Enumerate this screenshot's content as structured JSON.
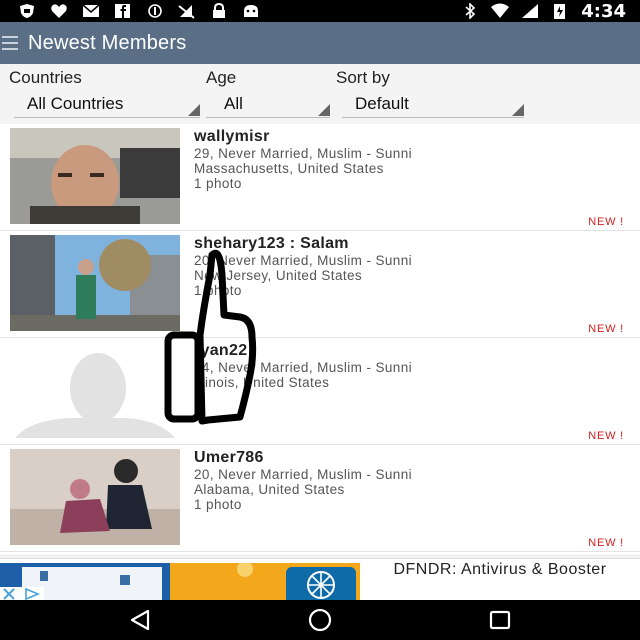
{
  "status_bar": {
    "time": "4:34",
    "icons_left": [
      "shield-icon",
      "heart-icon",
      "mail-icon",
      "facebook-icon",
      "circle-icon",
      "no-signal-icon",
      "lock-icon",
      "android-icon"
    ],
    "icons_right": [
      "bluetooth-icon",
      "wifi-icon",
      "signal-icon",
      "battery-icon"
    ]
  },
  "app_bar": {
    "title": "Newest Members"
  },
  "filters": {
    "countries": {
      "label": "Countries",
      "value": "All Countries"
    },
    "age": {
      "label": "Age",
      "value": "All"
    },
    "sort_by": {
      "label": "Sort by",
      "value": "Default"
    }
  },
  "members": [
    {
      "username": "wallymisr",
      "details": "29, Never Married, Muslim - Sunni",
      "location": "Massachusetts, United States",
      "photos": "1 photo",
      "badge": "NEW !"
    },
    {
      "username": "shehary123 : Salam",
      "details": "20, Never Married, Muslim - Sunni",
      "location": "New Jersey, United States",
      "photos": "1 photo",
      "badge": "NEW !"
    },
    {
      "username": "ryan22",
      "details": "34, Never Married, Muslim - Sunni",
      "location": "Illinois, United States",
      "photos": "",
      "badge": "NEW !"
    },
    {
      "username": "Umer786",
      "details": "20, Never Married, Muslim - Sunni",
      "location": "Alabama, United States",
      "photos": "1 photo",
      "badge": "NEW !"
    }
  ],
  "ad": {
    "text": "DFNDR: Antivirus & Booster"
  },
  "colors": {
    "app_bar": "#5a6f86",
    "badge": "#d21f1f",
    "status_bar": "#000000"
  }
}
